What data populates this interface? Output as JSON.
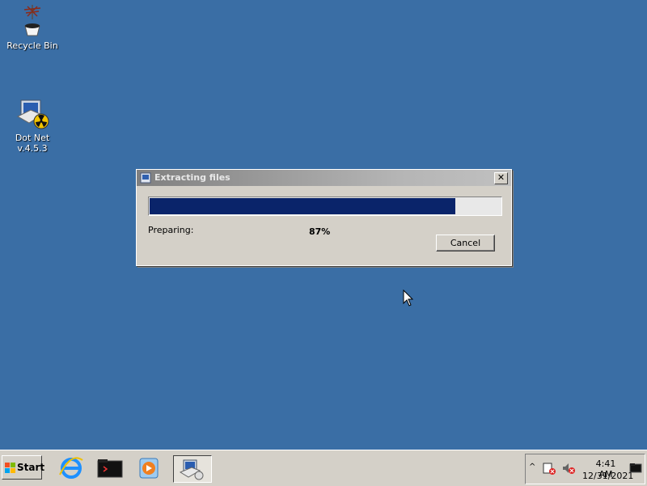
{
  "desktop": {
    "icons": [
      {
        "label": "Recycle Bin",
        "icon": "recycle-bin-icon"
      },
      {
        "label": "Dot Net v.4.5.3",
        "icon": "installer-icon"
      }
    ],
    "background_color": "#3a6ea5"
  },
  "dialog": {
    "title": "Extracting files",
    "status_label": "Preparing:",
    "percent_text": "87%",
    "progress_fraction": 0.87,
    "cancel_label": "Cancel",
    "close_glyph": "✕",
    "progress_color": "#0a246a"
  },
  "taskbar": {
    "start_label": "Start",
    "pinned": [
      {
        "icon": "internet-explorer-icon"
      },
      {
        "icon": "terminal-folder-icon"
      },
      {
        "icon": "media-player-icon"
      },
      {
        "icon": "installer-icon",
        "active": true
      }
    ],
    "tray": {
      "chevron": "^",
      "time": "4:41 AM",
      "date": "12/31/2021"
    }
  }
}
